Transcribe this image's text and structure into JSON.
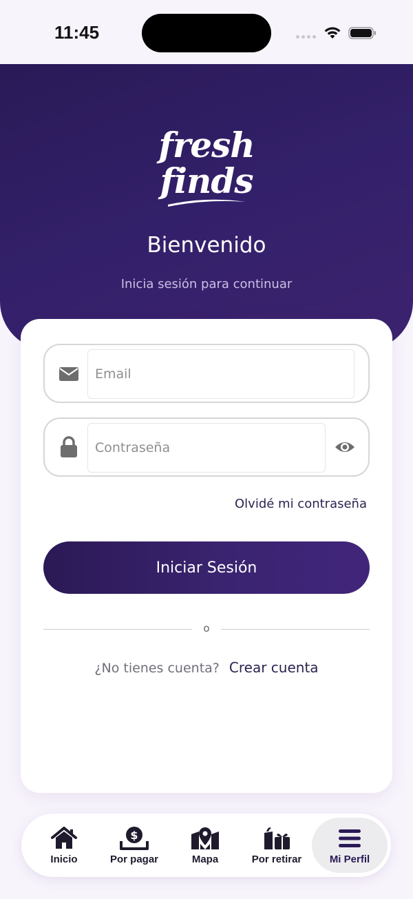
{
  "status_bar": {
    "time": "11:45"
  },
  "header": {
    "logo_line1": "fresh",
    "logo_line2": "finds",
    "title": "Bienvenido",
    "subtitle": "Inicia sesión para continuar"
  },
  "form": {
    "email_placeholder": "Email",
    "email_value": "",
    "password_placeholder": "Contraseña",
    "password_value": "",
    "forgot_password": "Olvidé mi contraseña",
    "login_button": "Iniciar Sesión",
    "divider": "o",
    "no_account": "¿No tienes cuenta?",
    "create_account": "Crear cuenta"
  },
  "icons": {
    "email": "envelope-icon",
    "password": "lock-icon",
    "toggle_password": "eye-icon"
  },
  "tabs": [
    {
      "label": "Inicio",
      "icon": "home-icon",
      "active": false
    },
    {
      "label": "Por pagar",
      "icon": "dollar-tray-icon",
      "active": false
    },
    {
      "label": "Mapa",
      "icon": "map-pin-icon",
      "active": false
    },
    {
      "label": "Por retirar",
      "icon": "gift-bag-icon",
      "active": false
    },
    {
      "label": "Mi Perfil",
      "icon": "hamburger-menu-icon",
      "active": true
    }
  ],
  "colors": {
    "primary": "#2a1a57",
    "primary_accent": "#41257a",
    "background": "#f8f4fc",
    "subtitle": "#cbbfe4",
    "link": "#2a2450"
  }
}
